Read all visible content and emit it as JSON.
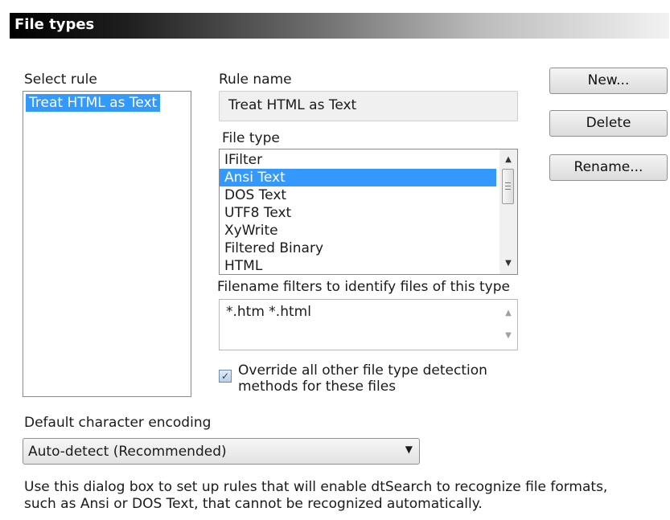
{
  "header": {
    "title": "File types"
  },
  "select_rule": {
    "label": "Select rule",
    "items": [
      "Treat HTML as Text"
    ],
    "selected": "Treat HTML as Text"
  },
  "rule_name": {
    "label": "Rule name",
    "value": "Treat HTML as Text"
  },
  "file_type": {
    "label": "File type",
    "items": [
      "IFilter",
      "Ansi Text",
      "DOS Text",
      "UTF8 Text",
      "XyWrite",
      "Filtered Binary",
      "HTML"
    ],
    "selected": "Ansi Text"
  },
  "filename_filters": {
    "label": "Filename filters to identify files of this type",
    "value": "*.htm *.html"
  },
  "override": {
    "checked": true,
    "label_line1": "Override all other file type detection",
    "label_line2": "methods for these files"
  },
  "buttons": {
    "new": "New...",
    "delete": "Delete",
    "rename": "Rename..."
  },
  "encoding": {
    "label": "Default character encoding",
    "value": "Auto-detect (Recommended)"
  },
  "footer": {
    "line1": "Use this dialog box to set up rules that will enable dtSearch to recognize file formats,",
    "line2": "such as Ansi or DOS Text, that cannot be recognized automatically."
  },
  "icons": {
    "scroll_up": "up-arrow-icon",
    "scroll_down": "down-arrow-icon",
    "dropdown": "chevron-down-icon",
    "checkmark": "checkmark-icon"
  }
}
